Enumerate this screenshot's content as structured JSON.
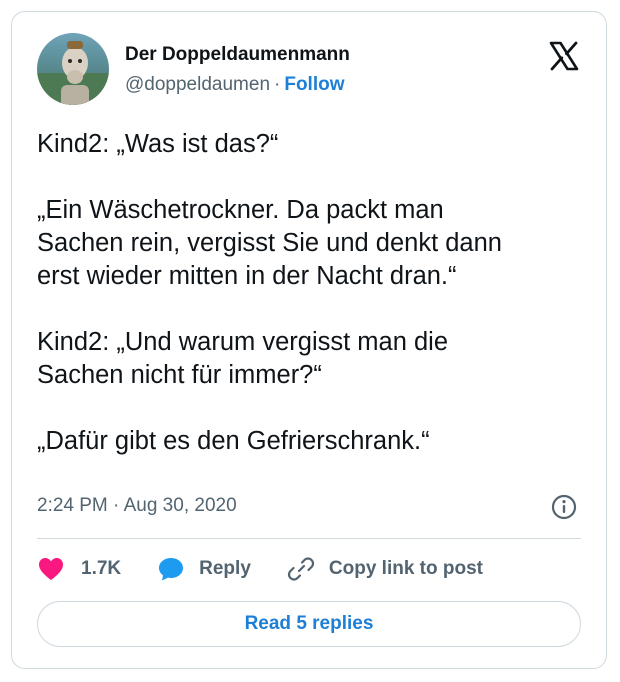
{
  "author": {
    "name": "Der Doppeldaumenmann",
    "handle": "@doppeldaumen",
    "separator": "·",
    "follow_label": "Follow",
    "avatar_icon": "avatar-image"
  },
  "platform_icon": "x-logo-icon",
  "tweet": {
    "paragraphs": [
      "Kind2: „Was ist das?“",
      "„Ein Wäschetrockner. Da packt man\nSachen rein, vergisst Sie und denkt dann\nerst wieder mitten in der Nacht dran.“",
      "Kind2: „Und warum vergisst man die\nSachen nicht für immer?“",
      "„Dafür gibt es den Gefrierschrank.“"
    ],
    "timestamp": "2:24 PM · Aug 30, 2020"
  },
  "actions": {
    "like_count": "1.7K",
    "reply_label": "Reply",
    "copy_label": "Copy link to post"
  },
  "read_replies_label": "Read 5 replies",
  "colors": {
    "accent": "#1d7fd6",
    "like": "#f91880",
    "muted": "#536471",
    "border": "#cfd9de"
  }
}
